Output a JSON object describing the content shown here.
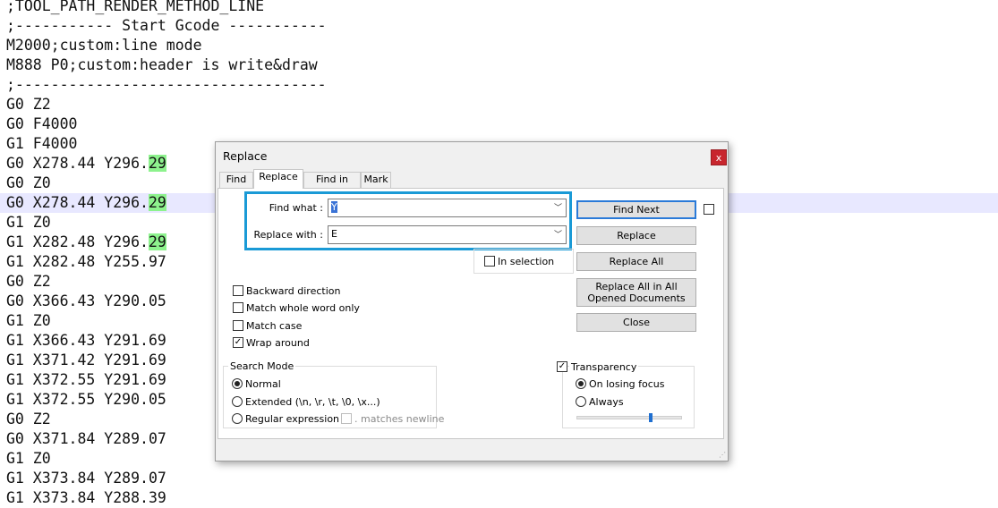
{
  "editor": {
    "lines": [
      {
        "text": ";TOOL_PATH_RENDER_METHOD_LINE"
      },
      {
        "text": ";----------- Start Gcode -----------"
      },
      {
        "text": "M2000;custom:line mode"
      },
      {
        "text": "M888 P0;custom:header is write&draw"
      },
      {
        "text": ";-----------------------------------"
      },
      {
        "text": "G0 Z2"
      },
      {
        "text": "G0 F4000"
      },
      {
        "text": "G1 F4000"
      },
      {
        "text": "G0 X278.44 Y296.",
        "match": "29"
      },
      {
        "text": "G0 Z0"
      },
      {
        "text": "G0 X278.44 Y296.",
        "match": "29",
        "current": true
      },
      {
        "text": "G1 Z0"
      },
      {
        "text": "G1 X282.48 Y296.",
        "match": "29"
      },
      {
        "text": "G1 X282.48 Y255.97"
      },
      {
        "text": "G0 Z2"
      },
      {
        "text": "G0 X366.43 Y290.05"
      },
      {
        "text": "G1 Z0"
      },
      {
        "text": "G1 X366.43 Y291.69"
      },
      {
        "text": "G1 X371.42 Y291.69"
      },
      {
        "text": "G1 X372.55 Y291.69"
      },
      {
        "text": "G1 X372.55 Y290.05"
      },
      {
        "text": "G0 Z2"
      },
      {
        "text": "G0 X371.84 Y289.07"
      },
      {
        "text": "G1 Z0"
      },
      {
        "text": "G1 X373.84 Y289.07"
      },
      {
        "text": "G1 X373.84 Y288.39"
      }
    ]
  },
  "dialog": {
    "title": "Replace",
    "close_glyph": "x",
    "tabs": [
      "Find",
      "Replace",
      "Find in Files",
      "Mark"
    ],
    "active_tab": "Replace",
    "find_what_label": "Find what :",
    "find_what_value": "Y",
    "replace_with_label": "Replace with :",
    "replace_with_value": "E",
    "in_selection_label": "In selection",
    "buttons": {
      "find_next": "Find Next",
      "replace": "Replace",
      "replace_all": "Replace All",
      "replace_all_opened": "Replace All in All Opened Documents",
      "close": "Close"
    },
    "options": {
      "backward": {
        "label": "Backward direction",
        "checked": false
      },
      "whole_word": {
        "label": "Match whole word only",
        "checked": false
      },
      "match_case": {
        "label": "Match case",
        "checked": false
      },
      "wrap_around": {
        "label": "Wrap around",
        "checked": true
      }
    },
    "search_mode": {
      "title": "Search Mode",
      "normal": "Normal",
      "extended": "Extended (\\n, \\r, \\t, \\0, \\x...)",
      "regex": "Regular expression",
      "matches_newline": ". matches newline",
      "selected": "Normal"
    },
    "transparency": {
      "label": "Transparency",
      "checked": true,
      "on_losing_focus": "On losing focus",
      "always": "Always",
      "selected": "On losing focus",
      "level": 0.7
    },
    "colors": {
      "accent": "#1a9ad6",
      "close_red": "#c8262e",
      "match_green": "#8df28d"
    }
  }
}
